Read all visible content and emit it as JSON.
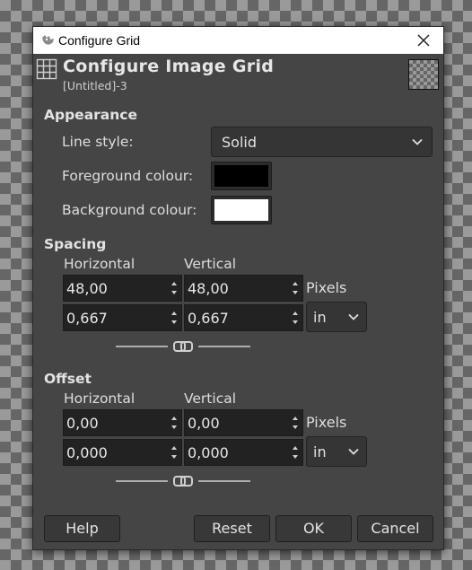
{
  "window": {
    "title": "Configure Grid"
  },
  "header": {
    "title": "Configure Image Grid",
    "subtitle": "[Untitled]-3"
  },
  "appearance": {
    "section_title": "Appearance",
    "line_style_label": "Line style:",
    "line_style_value": "Solid",
    "foreground_label": "Foreground colour:",
    "foreground_color": "#000000",
    "background_label": "Background colour:",
    "background_color": "#ffffff"
  },
  "spacing": {
    "section_title": "Spacing",
    "horizontal_label": "Horizontal",
    "vertical_label": "Vertical",
    "horizontal_px": "48,00",
    "vertical_px": "48,00",
    "pixels_label": "Pixels",
    "horizontal_in": "0,667",
    "vertical_in": "0,667",
    "unit_value": "in"
  },
  "offset": {
    "section_title": "Offset",
    "horizontal_label": "Horizontal",
    "vertical_label": "Vertical",
    "horizontal_px": "0,00",
    "vertical_px": "0,00",
    "pixels_label": "Pixels",
    "horizontal_in": "0,000",
    "vertical_in": "0,000",
    "unit_value": "in"
  },
  "buttons": {
    "help": "Help",
    "reset": "Reset",
    "ok": "OK",
    "cancel": "Cancel"
  },
  "icons": {
    "app": "gimp-wilber-icon",
    "close": "close-icon",
    "grid": "grid-icon",
    "chevron": "chevron-down-icon",
    "chain": "chain-link-icon"
  }
}
